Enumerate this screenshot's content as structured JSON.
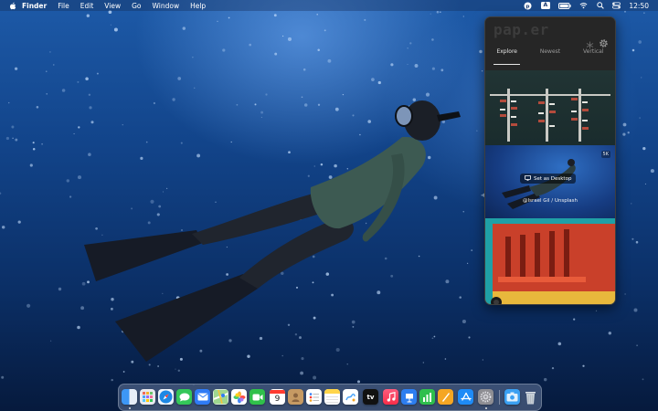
{
  "menubar": {
    "apple_icon": "apple-logo-icon",
    "app_name": "Finder",
    "items": [
      "File",
      "Edit",
      "View",
      "Go",
      "Window",
      "Help"
    ],
    "status_icons": [
      "paper-status-icon",
      "input-source-A-icon",
      "battery-icon",
      "wifi-icon",
      "search-icon",
      "control-center-icon"
    ],
    "input_source_label": "A",
    "clock": "12:50"
  },
  "widget": {
    "logo": "pap.er",
    "tabs": [
      {
        "label": "Explore",
        "active": true
      },
      {
        "label": "Newest",
        "active": false
      },
      {
        "label": "Vertical",
        "active": false
      }
    ],
    "tiles": [
      {
        "name": "tile-pier-aerial"
      },
      {
        "name": "tile-diver",
        "badge": "5K",
        "set_as_desktop_label": "Set as Desktop",
        "credit": "@Israel Gil / Unsplash"
      },
      {
        "name": "tile-red-building"
      }
    ]
  },
  "dock": {
    "apps": [
      {
        "name": "finder",
        "color": "#2d8cf0"
      },
      {
        "name": "launchpad",
        "color": "#e7e7e7"
      },
      {
        "name": "safari",
        "color": "#1e88e5"
      },
      {
        "name": "messages",
        "color": "#34c759"
      },
      {
        "name": "mail",
        "color": "#2f7bf5"
      },
      {
        "name": "maps",
        "color": "#4caf50"
      },
      {
        "name": "photos",
        "color": "#ffffff"
      },
      {
        "name": "facetime",
        "color": "#30c04a"
      },
      {
        "name": "calendar",
        "color": "#ffffff",
        "day": "9"
      },
      {
        "name": "contacts",
        "color": "#c69a63"
      },
      {
        "name": "reminders",
        "color": "#ffffff"
      },
      {
        "name": "notes",
        "color": "#ffd54a"
      },
      {
        "name": "freeform",
        "color": "#4aa3f7"
      },
      {
        "name": "tv",
        "color": "#111111",
        "label": "tv"
      },
      {
        "name": "music",
        "color": "#fa3c5a"
      },
      {
        "name": "keynote",
        "color": "#2d7ef0"
      },
      {
        "name": "numbers",
        "color": "#2fbf4d"
      },
      {
        "name": "pages",
        "color": "#f5a623"
      },
      {
        "name": "app-store",
        "color": "#1e8bf7"
      },
      {
        "name": "system-settings",
        "color": "#8e8e93"
      },
      {
        "name": "screenshot",
        "color": "#3aa0f2"
      },
      {
        "name": "trash",
        "color": "#c8d0d8"
      }
    ]
  }
}
